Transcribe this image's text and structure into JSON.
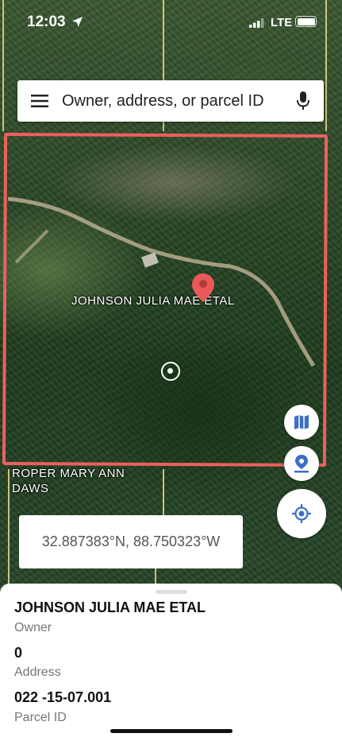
{
  "status_bar": {
    "time": "12:03",
    "network": "LTE"
  },
  "search": {
    "placeholder": "Owner, address, or parcel ID"
  },
  "map": {
    "parcel_labels": {
      "main_owner": "JOHNSON JULIA MAE ETAL",
      "neighbor_line1": "ROPER MARY ANN",
      "neighbor_line2": "DAWS"
    },
    "outline_color": "#ef5f5f",
    "pin_color": "#ea5a5a",
    "coordinates": "32.887383°N, 88.750323°W"
  },
  "parcel_info": {
    "owner_value": "JOHNSON JULIA MAE ETAL",
    "owner_label": "Owner",
    "address_value": "0",
    "address_label": "Address",
    "parcel_id_value": "022 -15-07.001",
    "parcel_id_label": "Parcel ID"
  },
  "icons": {
    "menu": "hamburger-icon",
    "mic": "microphone-icon",
    "layers": "map-icon",
    "place": "place-pin-icon",
    "locate": "my-location-icon"
  },
  "accent_color": "#3b6fc4"
}
